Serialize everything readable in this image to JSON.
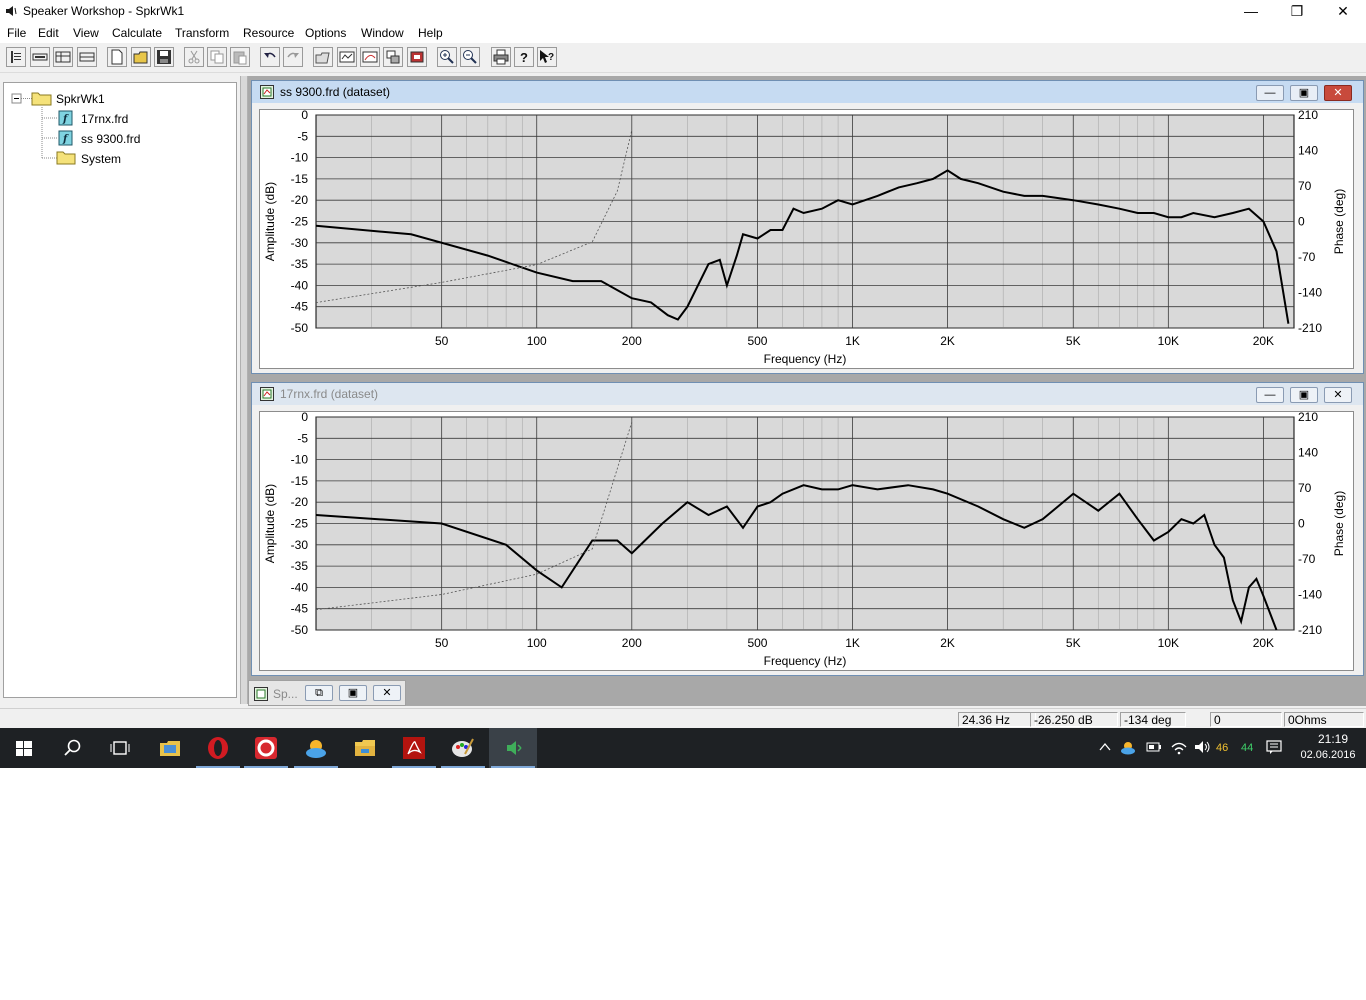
{
  "window": {
    "title": "Speaker Workshop - SpkrWk1",
    "controls": {
      "minimize": "—",
      "restore": "❐",
      "close": "✕"
    }
  },
  "menu": [
    "File",
    "Edit",
    "View",
    "Calculate",
    "Transform",
    "Resource",
    "Options",
    "Window",
    "Help"
  ],
  "toolbar": {
    "icons": [
      "properties-icon",
      "resource-icon",
      "table-icon",
      "grid-icon",
      "new-icon",
      "open-icon",
      "save-icon",
      "cut-icon",
      "copy-icon",
      "paste-icon",
      "undo-icon",
      "redo-icon",
      "open-folder-icon",
      "driver-icon",
      "chart-icon",
      "network-icon",
      "box-icon",
      "zoom-in-icon",
      "zoom-out-icon",
      "print-icon",
      "help-icon",
      "context-help-icon"
    ]
  },
  "tree": {
    "root": "SpkrWk1",
    "items": [
      "17rnx.frd",
      "ss 9300.frd",
      "System"
    ]
  },
  "charts": [
    {
      "window_title": "ss 9300.frd (dataset)",
      "active": true,
      "xlabel": "Frequency (Hz)",
      "ylabel_left": "Amplitude (dB)",
      "ylabel_right": "Phase (deg)",
      "x_ticks": [
        "50",
        "100",
        "200",
        "500",
        "1K",
        "2K",
        "5K",
        "10K",
        "20K"
      ],
      "y_left_ticks": [
        "0",
        "-5",
        "-10",
        "-15",
        "-20",
        "-25",
        "-30",
        "-35",
        "-40",
        "-45",
        "-50"
      ],
      "y_right_ticks": [
        "210",
        "140",
        "70",
        "0",
        "-70",
        "-140",
        "-210"
      ]
    },
    {
      "window_title": "17rnx.frd (dataset)",
      "active": false,
      "xlabel": "Frequency (Hz)",
      "ylabel_left": "Amplitude (dB)",
      "ylabel_right": "Phase (deg)",
      "x_ticks": [
        "50",
        "100",
        "200",
        "500",
        "1K",
        "2K",
        "5K",
        "10K",
        "20K"
      ],
      "y_left_ticks": [
        "0",
        "-5",
        "-10",
        "-15",
        "-20",
        "-25",
        "-30",
        "-35",
        "-40",
        "-45",
        "-50"
      ],
      "y_right_ticks": [
        "210",
        "140",
        "70",
        "0",
        "-70",
        "-140",
        "-210"
      ]
    }
  ],
  "chart_data": [
    {
      "type": "line",
      "title": "ss 9300.frd (dataset)",
      "xlabel": "Frequency (Hz)",
      "ylabel": "Amplitude (dB)",
      "y2label": "Phase (deg)",
      "xscale": "log",
      "xlim": [
        20,
        25000
      ],
      "ylim": [
        -50,
        0
      ],
      "y2lim": [
        -210,
        210
      ],
      "grid": true,
      "series": [
        {
          "axis": "left",
          "style": "solid",
          "x": [
            20,
            40,
            70,
            100,
            130,
            160,
            200,
            230,
            260,
            280,
            300,
            350,
            380,
            400,
            430,
            450,
            500,
            550,
            600,
            650,
            700,
            800,
            900,
            1000,
            1200,
            1400,
            1600,
            1800,
            2000,
            2200,
            2500,
            3000,
            3500,
            4000,
            5000,
            6000,
            7000,
            8000,
            9000,
            10000,
            11000,
            12000,
            14000,
            16000,
            18000,
            20000,
            22000,
            24000
          ],
          "y": [
            -26,
            -28,
            -33,
            -37,
            -39,
            -39,
            -43,
            -44,
            -47,
            -48,
            -45,
            -35,
            -34,
            -40,
            -33,
            -28,
            -29,
            -27,
            -27,
            -22,
            -23,
            -22,
            -20,
            -21,
            -19,
            -17,
            -16,
            -15,
            -13,
            -15,
            -16,
            -18,
            -19,
            -19,
            -20,
            -21,
            -22,
            -23,
            -23,
            -24,
            -24,
            -23,
            -24,
            -23,
            -22,
            -25,
            -32,
            -49
          ]
        },
        {
          "axis": "right",
          "style": "dotted",
          "x": [
            20,
            50,
            100,
            150,
            180,
            200
          ],
          "y": [
            -160,
            -120,
            -85,
            -40,
            60,
            180
          ]
        }
      ]
    },
    {
      "type": "line",
      "title": "17rnx.frd (dataset)",
      "xlabel": "Frequency (Hz)",
      "ylabel": "Amplitude (dB)",
      "y2label": "Phase (deg)",
      "xscale": "log",
      "xlim": [
        20,
        25000
      ],
      "ylim": [
        -50,
        0
      ],
      "y2lim": [
        -210,
        210
      ],
      "grid": true,
      "series": [
        {
          "axis": "left",
          "style": "solid",
          "x": [
            20,
            50,
            80,
            100,
            120,
            150,
            180,
            200,
            250,
            300,
            350,
            400,
            450,
            500,
            550,
            600,
            700,
            800,
            900,
            1000,
            1200,
            1500,
            1800,
            2000,
            2500,
            3000,
            3500,
            4000,
            5000,
            6000,
            7000,
            8000,
            9000,
            10000,
            11000,
            12000,
            13000,
            14000,
            15000,
            16000,
            17000,
            18000,
            19000,
            20000,
            22000
          ],
          "y": [
            -23,
            -25,
            -30,
            -36,
            -40,
            -29,
            -29,
            -32,
            -25,
            -20,
            -23,
            -21,
            -26,
            -21,
            -20,
            -18,
            -16,
            -17,
            -17,
            -16,
            -17,
            -16,
            -17,
            -18,
            -21,
            -24,
            -26,
            -24,
            -18,
            -22,
            -18,
            -24,
            -29,
            -27,
            -24,
            -25,
            -23,
            -30,
            -33,
            -43,
            -48,
            -40,
            -38,
            -42,
            -50
          ]
        },
        {
          "axis": "right",
          "style": "dotted",
          "x": [
            20,
            50,
            100,
            150,
            200
          ],
          "y": [
            -170,
            -140,
            -100,
            -50,
            200
          ]
        }
      ]
    }
  ],
  "minimized": {
    "label": "Sp...",
    "buttons": [
      "⧉",
      "▣",
      "✕"
    ]
  },
  "status": {
    "freq": "24.36 Hz",
    "amp": "-26.250 dB",
    "phase": "-134 deg",
    "field4": "0",
    "field5": "0Ohms"
  },
  "taskbar": {
    "apps": [
      "start-icon",
      "search-icon",
      "task-view-icon",
      "explorer-icon",
      "opera-icon",
      "ccleaner-icon",
      "weather-icon",
      "file-explorer-icon",
      "acrobat-icon",
      "paint-icon",
      "speaker-workshop-icon"
    ],
    "tray": {
      "temp1": "46",
      "temp2": "44",
      "time": "21:19",
      "date": "02.06.2016"
    }
  },
  "colors": {
    "plot_bg": "#d9d9d9",
    "grid": "#3a3a3a",
    "curve": "#000000",
    "active_caption": "#c6dbf2",
    "inactive_caption": "#dde6f0",
    "close_red": "#c84a3c"
  }
}
